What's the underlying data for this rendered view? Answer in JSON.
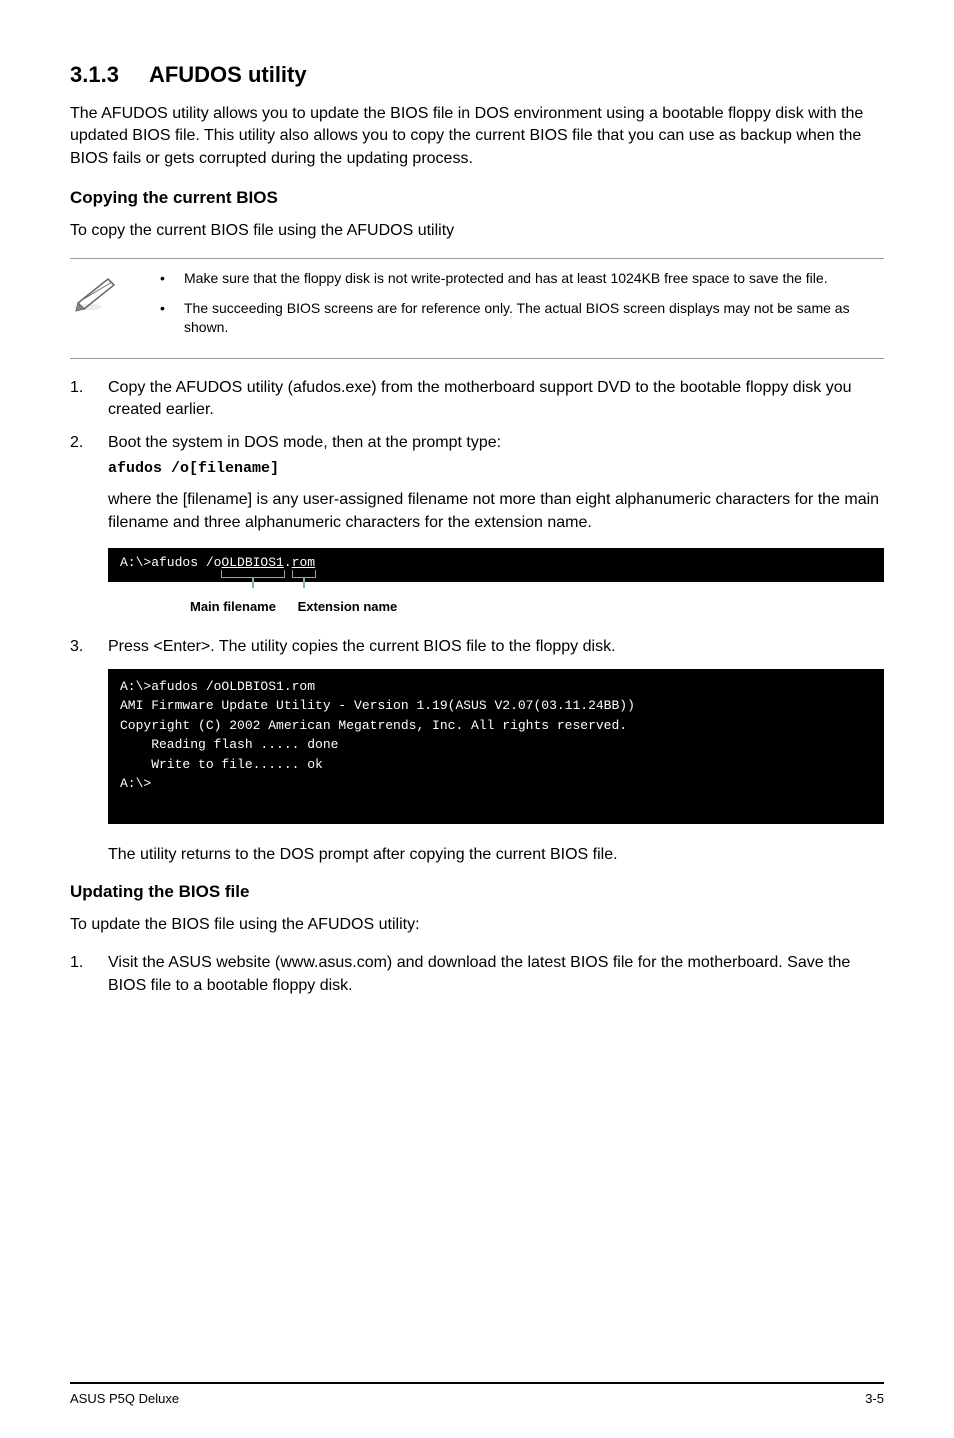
{
  "heading": {
    "number": "3.1.3",
    "title": "AFUDOS utility"
  },
  "intro": "The AFUDOS utility allows you to update the BIOS file in DOS environment using a bootable floppy disk with the updated BIOS file. This utility also allows you to copy the current BIOS file that you can use as backup when the BIOS fails or gets corrupted during the updating process.",
  "copying": {
    "heading": "Copying the current BIOS",
    "intro": "To copy the current BIOS file using the AFUDOS utility",
    "notes": {
      "bullet1": "Make sure that the floppy disk is not write-protected and has at least 1024KB free space to save the file.",
      "bullet2": "The succeeding BIOS screens are for reference only. The actual BIOS screen displays may not be same as shown."
    },
    "step1": {
      "num": "1.",
      "text": "Copy the AFUDOS utility (afudos.exe) from the motherboard support DVD to the bootable floppy disk you created earlier."
    },
    "step2": {
      "num": "2.",
      "text": "Boot the system in DOS mode, then at the prompt type:",
      "code": "afudos /o[filename]"
    },
    "where": "where the [filename] is any user-assigned filename not more than eight alphanumeric characters  for the main filename and three alphanumeric characters for the extension name.",
    "cmdline": {
      "prefix": "A:\\>afudos /o",
      "main": "OLDBIOS1",
      "dot": ".",
      "ext": "rom"
    },
    "annotation": {
      "main_label": "Main filename",
      "ext_label": "Extension name"
    },
    "step3": {
      "num": "3.",
      "text": "Press <Enter>. The utility copies the current BIOS file to the floppy disk."
    },
    "terminal2": {
      "l1": "A:\\>afudos /oOLDBIOS1.rom",
      "l2": "AMI Firmware Update Utility - Version 1.19(ASUS V2.07(03.11.24BB))",
      "l3": "Copyright (C) 2002 American Megatrends, Inc. All rights reserved.",
      "l4": "    Reading flash ..... done",
      "l5": "    Write to file...... ok",
      "l6": "A:\\>"
    },
    "after": "The utility returns to the DOS prompt after copying the current BIOS file."
  },
  "updating": {
    "heading": "Updating the BIOS file",
    "intro": "To update the BIOS file using the AFUDOS utility:",
    "step1": {
      "num": "1.",
      "text": "Visit the ASUS website (www.asus.com) and download the latest BIOS file for the motherboard. Save the BIOS file to a bootable floppy disk."
    }
  },
  "footer": {
    "left": "ASUS P5Q Deluxe",
    "right": "3-5"
  }
}
